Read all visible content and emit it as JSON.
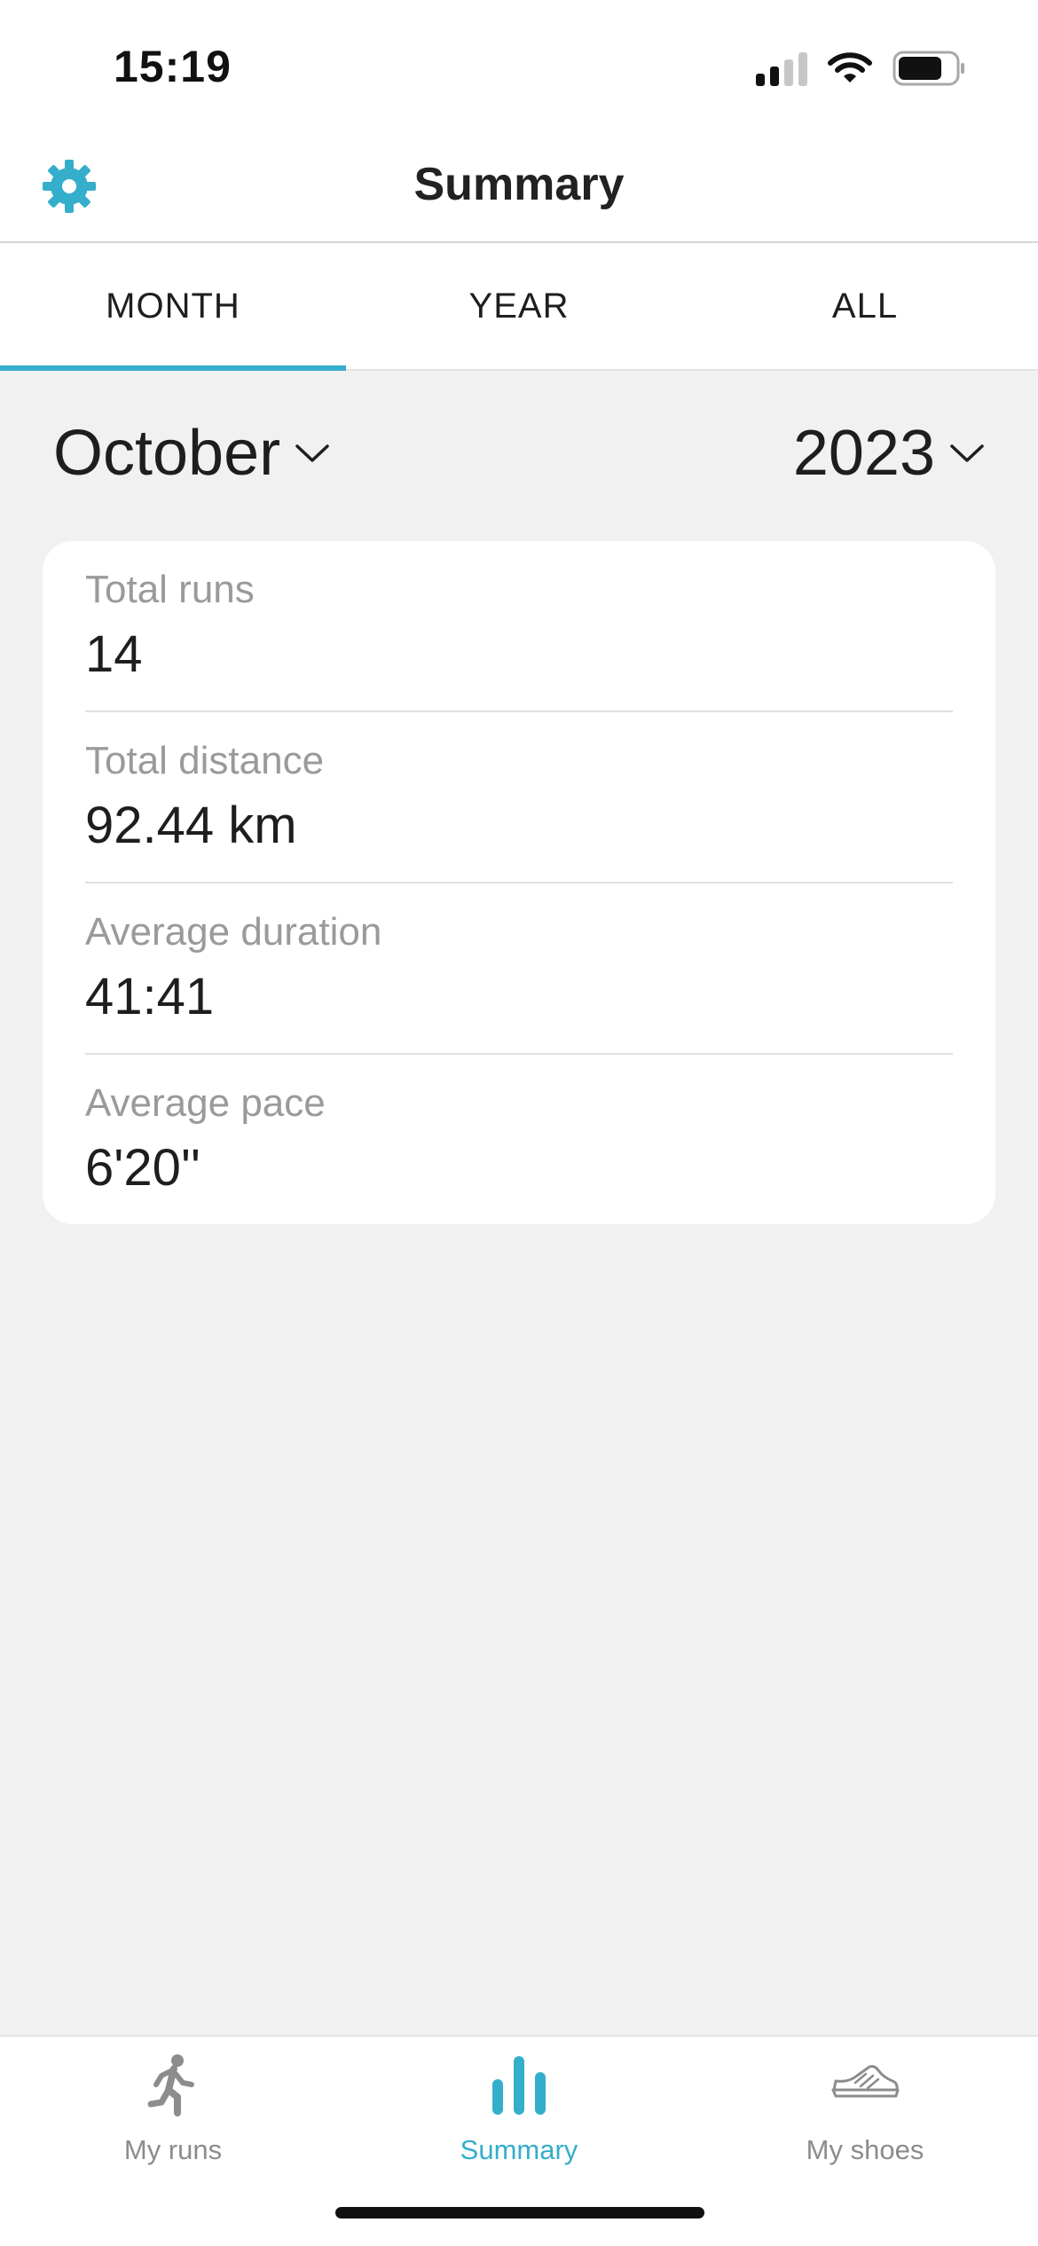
{
  "status_bar": {
    "time": "15:19",
    "icons": [
      "cellular-signal-icon",
      "wifi-icon",
      "battery-icon"
    ]
  },
  "header": {
    "title": "Summary",
    "settings_icon": "gear-icon"
  },
  "tabs": [
    {
      "label": "MONTH",
      "active": true
    },
    {
      "label": "YEAR",
      "active": false
    },
    {
      "label": "ALL",
      "active": false
    }
  ],
  "period": {
    "month": "October",
    "year": "2023"
  },
  "stats": [
    {
      "label": "Total runs",
      "value": "14"
    },
    {
      "label": "Total distance",
      "value": "92.44 km"
    },
    {
      "label": "Average duration",
      "value": "41:41"
    },
    {
      "label": "Average pace",
      "value": "6'20''"
    }
  ],
  "tab_bar": [
    {
      "label": "My runs",
      "icon": "runner-icon",
      "active": false
    },
    {
      "label": "Summary",
      "icon": "bar-chart-icon",
      "active": true
    },
    {
      "label": "My shoes",
      "icon": "shoe-icon",
      "active": false
    }
  ],
  "colors": {
    "accent": "#35aecb",
    "background": "#f1f1f1",
    "inactive_text": "#8c8c8c"
  }
}
